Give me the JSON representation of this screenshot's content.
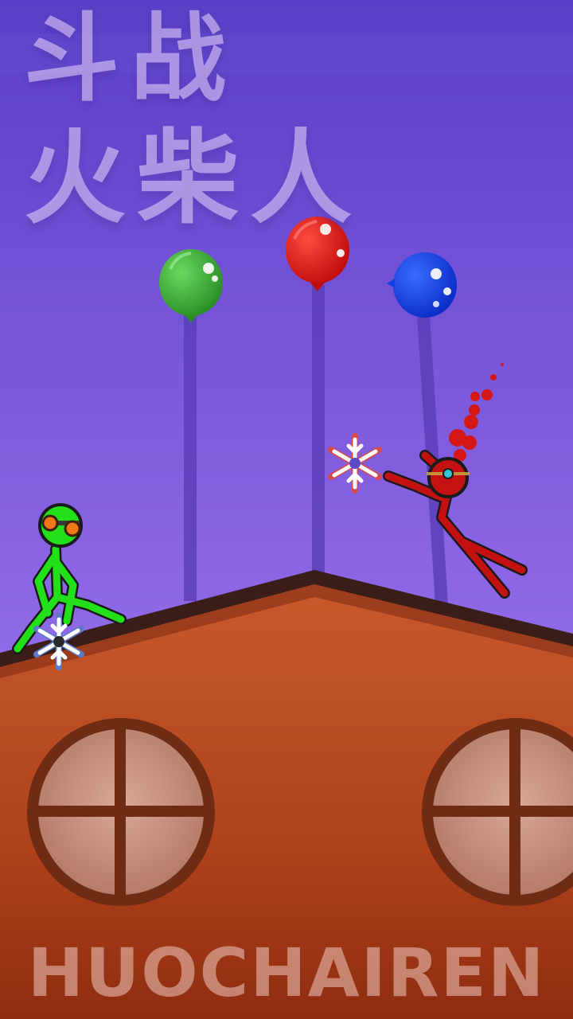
{
  "title": {
    "line1": "斗战",
    "line2": "火柴人"
  },
  "footer": {
    "text": "HUOCHAIREN"
  },
  "balloons": [
    {
      "name": "green-balloon",
      "color": "#3aa832"
    },
    {
      "name": "red-balloon",
      "color": "#e01818"
    },
    {
      "name": "blue-balloon",
      "color": "#1040e0"
    }
  ],
  "fighters": [
    {
      "name": "green-stickman",
      "color": "#1fd81a",
      "weapon": "shuriken-icon"
    },
    {
      "name": "red-stickman",
      "color": "#c41212",
      "weapon": "shuriken-icon"
    }
  ],
  "colors": {
    "sky_top": "#5a3ec8",
    "sky_bottom": "#a27ef0",
    "roof": "#c0502a",
    "roof_dark": "#8a2e14",
    "roof_edge": "#3a1c18"
  }
}
